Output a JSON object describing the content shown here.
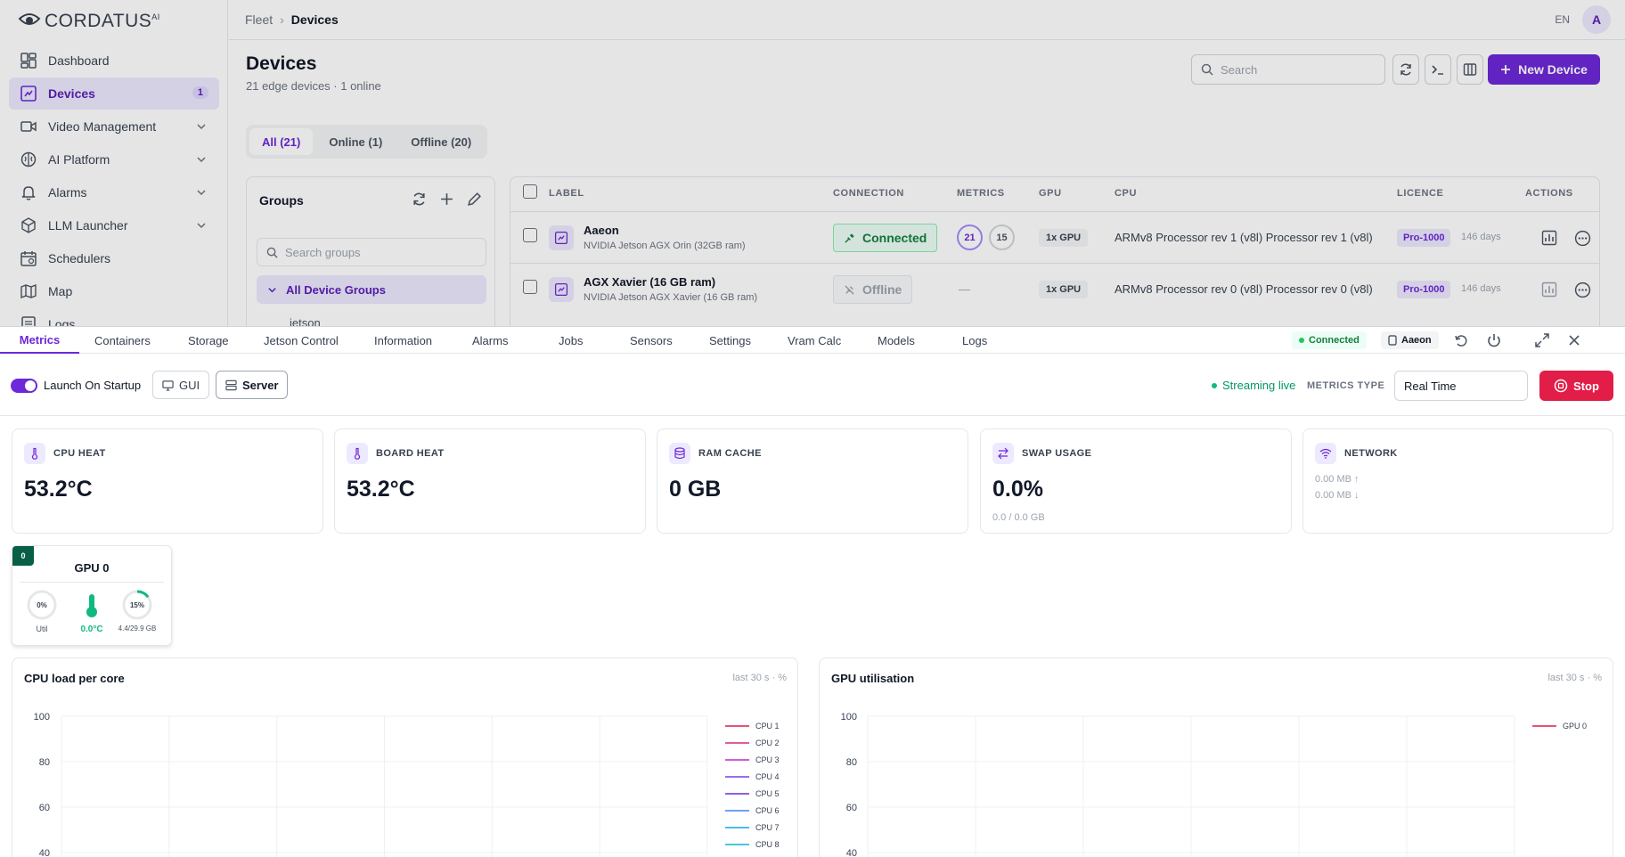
{
  "app": {
    "logo": "CORDATUS",
    "logo_sup": "AI",
    "breadcrumb": [
      "Fleet",
      "Devices"
    ],
    "lang": "EN",
    "avatar": "A"
  },
  "sidebar": {
    "items": [
      {
        "label": "Dashboard",
        "icon": "dashboard-icon"
      },
      {
        "label": "Devices",
        "icon": "devices-icon",
        "badge": "1",
        "active": true
      },
      {
        "label": "Video Management",
        "icon": "video-icon",
        "expandable": true
      },
      {
        "label": "AI Platform",
        "icon": "brain-icon",
        "expandable": true
      },
      {
        "label": "Alarms",
        "icon": "bell-icon",
        "expandable": true
      },
      {
        "label": "LLM Launcher",
        "icon": "cube-icon",
        "expandable": true
      },
      {
        "label": "Schedulers",
        "icon": "calendar-icon"
      },
      {
        "label": "Map",
        "icon": "map-icon"
      },
      {
        "label": "Logs",
        "icon": "logs-icon"
      }
    ]
  },
  "page": {
    "title": "Devices",
    "subtitle": "21 edge devices · 1 online",
    "search_placeholder": "Search",
    "new_device": "New Device",
    "filters": [
      "All (21)",
      "Online (1)",
      "Offline (20)"
    ]
  },
  "groups": {
    "title": "Groups",
    "search_placeholder": "Search groups",
    "all": "All Device Groups",
    "sub": "jetson"
  },
  "table": {
    "headers": [
      "LABEL",
      "CONNECTION",
      "METRICS",
      "GPU",
      "CPU",
      "LICENCE",
      "ACTIONS"
    ],
    "rows": [
      {
        "name": "Aaeon",
        "model": "NVIDIA Jetson AGX Orin (32GB ram)",
        "connection": "Connected",
        "metrics": [
          "21",
          "15"
        ],
        "gpu": "1x GPU",
        "cpu": "ARMv8 Processor rev 1 (v8l) Processor rev 1 (v8l)",
        "licence": "Pro-1000",
        "days": "146 days"
      },
      {
        "name": "AGX Xavier (16 GB ram)",
        "model": "NVIDIA Jetson AGX Xavier (16 GB ram)",
        "connection": "Offline",
        "metrics_empty": "—",
        "gpu": "1x GPU",
        "cpu": "ARMv8 Processor rev 0 (v8l) Processor rev 0 (v8l)",
        "licence": "Pro-1000",
        "days": "146 days"
      }
    ]
  },
  "panel": {
    "tabs": [
      "Metrics",
      "Containers",
      "Storage",
      "Jetson Control",
      "Information",
      "Alarms",
      "Jobs",
      "Sensors",
      "Settings",
      "Vram Calc",
      "Models",
      "Logs"
    ],
    "status": "Connected",
    "device": "Aaeon",
    "launch_label": "Launch On Startup",
    "gui_label": "GUI",
    "server_label": "Server",
    "streaming": "Streaming live",
    "metrics_type_label": "METRICS TYPE",
    "metrics_type_value": "Real Time",
    "stop_label": "Stop"
  },
  "metrics": {
    "cpu_heat": {
      "label": "CPU HEAT",
      "value": "53.2°C"
    },
    "board_heat": {
      "label": "BOARD HEAT",
      "value": "53.2°C"
    },
    "ram_cache": {
      "label": "RAM CACHE",
      "value": "0 GB"
    },
    "swap": {
      "label": "SWAP USAGE",
      "value": "0.0%",
      "sub": "0.0 / 0.0 GB"
    },
    "network": {
      "label": "NETWORK",
      "up": "0.00 MB ↑",
      "down": "0.00 MB ↓"
    }
  },
  "gpu_card": {
    "badge": "0",
    "title": "GPU 0",
    "util_value": "0%",
    "util_label": "Util",
    "temp": "0.0°C",
    "mem_pct": "15%",
    "mem_label": "4.4/29.9 GB",
    "mem_fraction": 0.15
  },
  "chart_data": [
    {
      "type": "line",
      "title": "CPU load per core",
      "meta": "last 30 s · %",
      "yticks": [
        "100",
        "80",
        "60",
        "40"
      ],
      "series": [
        {
          "name": "CPU 1",
          "color": "#e11d48"
        },
        {
          "name": "CPU 2",
          "color": "#db2777"
        },
        {
          "name": "CPU 3",
          "color": "#c026d3"
        },
        {
          "name": "CPU 4",
          "color": "#7c3aed"
        },
        {
          "name": "CPU 5",
          "color": "#6d28d9"
        },
        {
          "name": "CPU 6",
          "color": "#3b82f6"
        },
        {
          "name": "CPU 7",
          "color": "#0ea5e9"
        },
        {
          "name": "CPU 8",
          "color": "#06b6d4"
        }
      ]
    },
    {
      "type": "line",
      "title": "GPU utilisation",
      "meta": "last 30 s · %",
      "yticks": [
        "100",
        "80",
        "60",
        "40"
      ],
      "series": [
        {
          "name": "GPU 0",
          "color": "#e11d48"
        }
      ]
    }
  ]
}
